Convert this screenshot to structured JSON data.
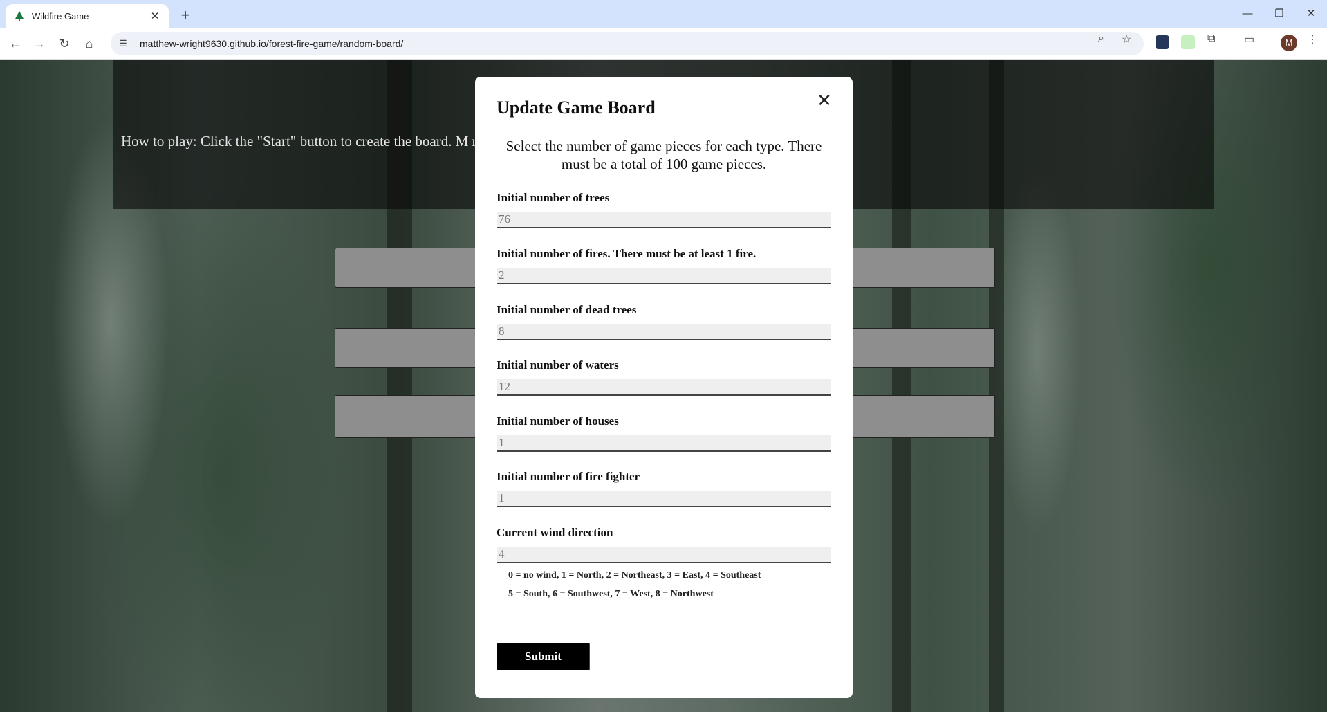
{
  "browser": {
    "tab_title": "Wildfire Game",
    "url": "matthew-wright9630.github.io/forest-fire-game/random-board/",
    "avatar_letter": "M"
  },
  "page": {
    "how_to_play": "How to play: Click the \"Start\" button to create the board. M                                                                                                       re. Next, click the \"Spread Fire\" button to see how the fire"
  },
  "modal": {
    "title": "Update Game Board",
    "description": "Select the number of game pieces for each type. There must be a total of 100 game pieces.",
    "fields": [
      {
        "label": "Initial number of trees",
        "value": "76"
      },
      {
        "label": "Initial number of fires. There must be at least 1 fire.",
        "value": "2"
      },
      {
        "label": "Initial number of dead trees",
        "value": "8"
      },
      {
        "label": "Initial number of waters",
        "value": "12"
      },
      {
        "label": "Initial number of houses",
        "value": "1"
      },
      {
        "label": "Initial number of fire fighter",
        "value": "1"
      },
      {
        "label": "Current wind direction",
        "value": "4"
      }
    ],
    "wind_help_line1": "0 = no wind, 1 = North, 2 = Northeast, 3 = East, 4 = Southeast",
    "wind_help_line2": "5 = South, 6 = Southwest, 7 = West, 8 = Northwest",
    "submit_label": "Submit",
    "close_symbol": "✕"
  },
  "icons": {
    "favicon": "tree-icon",
    "back": "back-arrow-icon",
    "forward": "forward-arrow-icon",
    "reload": "reload-icon",
    "home": "home-icon",
    "site_info": "site-info-icon",
    "zoom": "zoom-icon",
    "bookmark": "star-icon",
    "extensions": "puzzle-icon"
  },
  "colors": {
    "tab_strip": "#d3e3fd",
    "modal_bg": "#ffffff",
    "submit_bg": "#000000",
    "bg_button": "#8e8e8e"
  }
}
